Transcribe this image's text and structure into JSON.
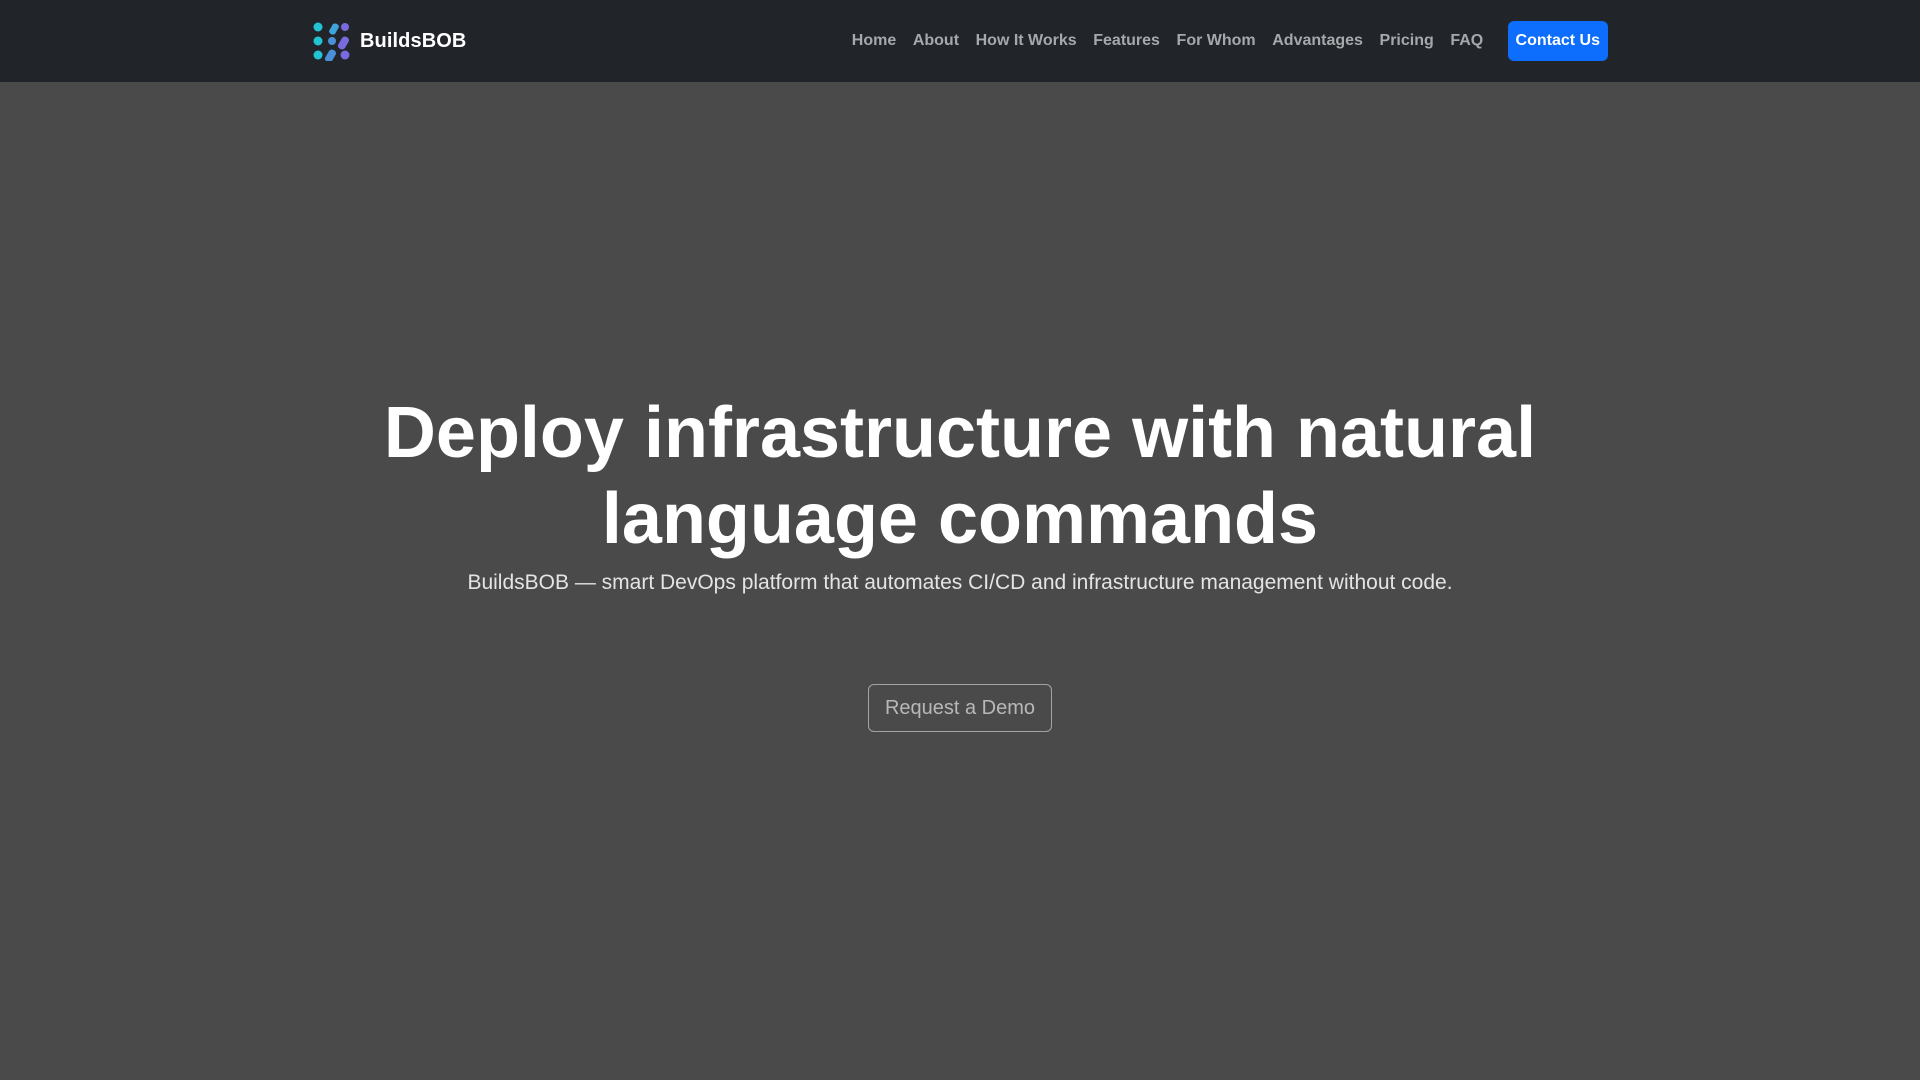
{
  "brand": {
    "name": "BuildsBOB",
    "logo_icon": "dots-grid-logo-icon",
    "logo_colors": [
      "#22c4d4",
      "#4a90d8",
      "#7a6ae0"
    ]
  },
  "nav": {
    "items": [
      {
        "label": "Home"
      },
      {
        "label": "About"
      },
      {
        "label": "How It Works"
      },
      {
        "label": "Features"
      },
      {
        "label": "For Whom"
      },
      {
        "label": "Advantages"
      },
      {
        "label": "Pricing"
      },
      {
        "label": "FAQ"
      }
    ],
    "contact_label": "Contact Us"
  },
  "hero": {
    "title": "Deploy infrastructure with natural language commands",
    "subtitle": "BuildsBOB — smart DevOps platform that automates CI/CD and infrastructure management without code.",
    "cta_label": "Request a Demo"
  },
  "colors": {
    "navbar_bg": "#212429",
    "hero_bg": "#4a4a4a",
    "accent": "#0d6efd"
  }
}
